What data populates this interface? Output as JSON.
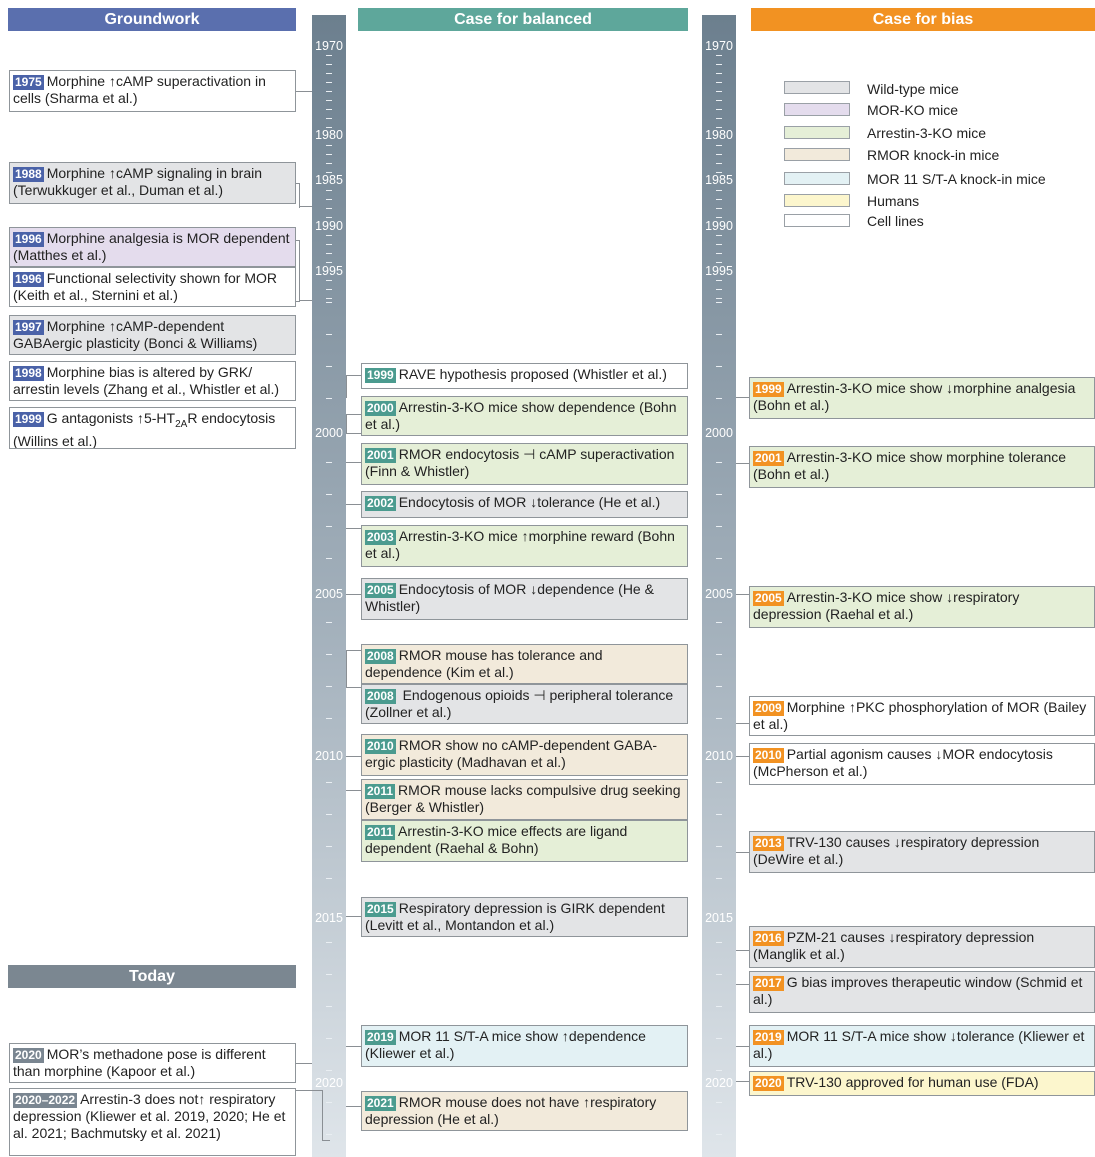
{
  "headers": {
    "groundwork": "Groundwork",
    "balanced": "Case for balanced",
    "bias": "Case for bias",
    "today": "Today"
  },
  "colors": {
    "groundwork_header": "#5a6fae",
    "balanced_header": "#5ea79b",
    "bias_header": "#f29222",
    "today_header": "#7b8791"
  },
  "axis": {
    "year_labels": [
      "1970",
      "1980",
      "1985",
      "1990",
      "1995",
      "2000",
      "2005",
      "2010",
      "2015",
      "2020"
    ]
  },
  "legend": [
    {
      "label": "Wild-type mice",
      "color": "#e3e4e6"
    },
    {
      "label": "MOR-KO mice",
      "color": "#e4dced"
    },
    {
      "label": "Arrestin-3-KO mice",
      "color": "#e5efd7"
    },
    {
      "label": "RMOR knock-in mice",
      "color": "#f2eadb"
    },
    {
      "label": "MOR 11 S/T-A knock-in mice",
      "color": "#e3f1f4"
    },
    {
      "label": "Humans",
      "color": "#fcf6cd"
    },
    {
      "label": "Cell lines",
      "color": "#ffffff"
    }
  ],
  "groundwork": [
    {
      "year": "1975",
      "text": "Morphine ↑cAMP superactivation in cells (Sharma et al.)",
      "category": "Cell lines"
    },
    {
      "year": "1988",
      "text": "Morphine ↑cAMP signaling in brain (Terwukkuger et al., Duman et al.)",
      "category": "Wild-type mice"
    },
    {
      "year": "1996",
      "text": "Morphine analgesia is MOR dependent (Matthes et al.)",
      "category": "MOR-KO mice"
    },
    {
      "year": "1996",
      "text": "Functional selectivity shown for MOR (Keith  et al., Sternini et al.)",
      "category": "Cell lines"
    },
    {
      "year": "1997",
      "text": "Morphine ↑cAMP-dependent GABAergic plasticity (Bonci & Williams)",
      "category": "Wild-type mice"
    },
    {
      "year": "1998",
      "text": "Morphine bias is altered by GRK/ arrestin levels (Zhang et al., Whistler et al.)",
      "category": "Cell lines"
    },
    {
      "year": "1999",
      "text_before": "G antagonists ↑5-HT",
      "text_sub": "2A",
      "text_after": "R endocytosis (Willins et al.)",
      "category": "Cell lines"
    }
  ],
  "today": [
    {
      "year": "2020",
      "text": "MOR’s methadone pose is different than morphine (Kapoor et al.)",
      "category": "Cell lines"
    },
    {
      "year": "2020–2022",
      "text": "Arrestin-3 does not↑ respiratory depression (Kliewer et al. 2019, 2020; He et al. 2021; Bachmutsky et al. 2021)",
      "category": "Cell lines"
    }
  ],
  "balanced": [
    {
      "year": "1999",
      "text": "RAVE hypothesis proposed (Whistler et al.)",
      "category": "Cell lines"
    },
    {
      "year": "2000",
      "text": "Arrestin-3-KO mice show dependence (Bohn et al.)",
      "category": "Arrestin-3-KO mice"
    },
    {
      "year": "2001",
      "text": "RMOR endocytosis ⊣ cAMP superactivation (Finn & Whistler)",
      "category": "Arrestin-3-KO mice"
    },
    {
      "year": "2002",
      "text": "Endocytosis of MOR ↓tolerance (He et al.)",
      "category": "Wild-type mice"
    },
    {
      "year": "2003",
      "text": "Arrestin-3-KO mice ↑morphine reward (Bohn et al.)",
      "category": "Arrestin-3-KO mice"
    },
    {
      "year": "2005",
      "text": "Endocytosis of MOR ↓dependence (He & Whistler)",
      "category": "Wild-type mice"
    },
    {
      "year": "2008",
      "text": "RMOR mouse has tolerance and dependence (Kim et al.)",
      "category": "RMOR knock-in mice"
    },
    {
      "year": "2008",
      "text": " Endogenous opioids ⊣ peripheral tolerance (Zollner et al.)",
      "category": "Wild-type mice"
    },
    {
      "year": "2010",
      "text": "RMOR  show no cAMP-dependent GABA-ergic plasticity (Madhavan et al.)",
      "category": "RMOR knock-in mice"
    },
    {
      "year": "2011",
      "text": "RMOR mouse lacks  compulsive drug seeking (Berger & Whistler)",
      "category": "RMOR knock-in mice"
    },
    {
      "year": "2011",
      "text": "Arrestin-3-KO mice effects are ligand dependent (Raehal & Bohn)",
      "category": "Arrestin-3-KO mice"
    },
    {
      "year": "2015",
      "text": "Respiratory depression is GIRK dependent (Levitt et al., Montandon et al.)",
      "category": "Wild-type mice"
    },
    {
      "year": "2019",
      "text": "MOR 11 S/T-A mice show ↑dependence (Kliewer et al.)",
      "category": "MOR 11 S/T-A knock-in mice"
    },
    {
      "year": "2021",
      "text": "RMOR mouse does not have ↑respiratory depression (He et al.)",
      "category": "RMOR knock-in mice"
    }
  ],
  "bias": [
    {
      "year": "1999",
      "text": "Arrestin-3-KO mice show ↓morphine analgesia (Bohn et al.)",
      "category": "Arrestin-3-KO mice"
    },
    {
      "year": "2001",
      "text": "Arrestin-3-KO mice show morphine tolerance (Bohn et al.)",
      "category": "Arrestin-3-KO mice"
    },
    {
      "year": "2005",
      "text": "Arrestin-3-KO mice show ↓respiratory depression (Raehal et al.)",
      "category": "Arrestin-3-KO mice"
    },
    {
      "year": "2009",
      "text": "Morphine ↑PKC phosphorylation of MOR (Bailey et al.)",
      "category": "Cell lines"
    },
    {
      "year": "2010",
      "text": "Partial agonism causes ↓MOR  endocytosis (McPherson et al.)",
      "category": "Cell lines"
    },
    {
      "year": "2013",
      "text": "TRV-130 causes ↓respiratory depression (DeWire et al.)",
      "category": "Wild-type mice"
    },
    {
      "year": "2016",
      "text": "PZM-21 causes ↓respiratory depression (Manglik et al.)",
      "category": "Wild-type mice"
    },
    {
      "year": "2017",
      "text": "G bias  improves therapeutic window (Schmid et al.)",
      "category": "Wild-type mice"
    },
    {
      "year": "2019",
      "text": "MOR 11 S/T-A mice show ↓tolerance (Kliewer et al.)",
      "category": "MOR 11 S/T-A knock-in mice"
    },
    {
      "year": "2020",
      "text": "TRV-130 approved for human use (FDA)",
      "category": "Humans"
    }
  ]
}
